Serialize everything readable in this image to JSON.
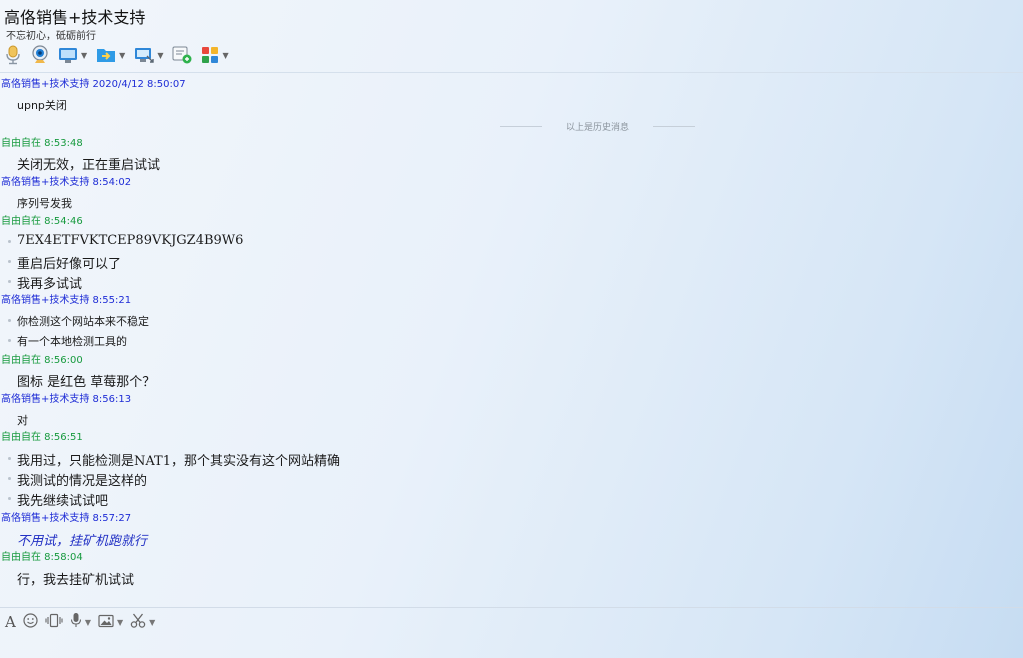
{
  "header": {
    "title": "高佫销售+技术支持",
    "subtitle": "不忘初心，砥砺前行",
    "toolbar": [
      {
        "icon": "microphone-icon"
      },
      {
        "icon": "webcam-icon"
      },
      {
        "icon": "screen-share-icon"
      },
      {
        "icon": "file-transfer-icon"
      },
      {
        "icon": "remote-desktop-icon"
      },
      {
        "icon": "new-chat-icon"
      },
      {
        "icon": "apps-icon"
      }
    ]
  },
  "chat": {
    "divider_text": "以上是历史消息",
    "messages": [
      {
        "sender": "高佫销售+技术支持 2020/4/12 8:50:07",
        "role": "staff",
        "lines": [
          "upnp关闭"
        ]
      },
      {
        "sender": "自由自在  8:53:48",
        "role": "user",
        "lines": [
          "关闭无效，正在重启试试"
        ]
      },
      {
        "sender": "高佫销售+技术支持  8:54:02",
        "role": "staff",
        "lines": [
          "序列号发我"
        ]
      },
      {
        "sender": "自由自在  8:54:46",
        "role": "user",
        "lines": [
          "7EX4ETFVKTCEP89VKJGZ4B9W6",
          "重启后好像可以了",
          "我再多试试"
        ]
      },
      {
        "sender": "高佫销售+技术支持  8:55:21",
        "role": "staff",
        "lines": [
          "你检测这个网站本来不稳定",
          "有一个本地检测工具的"
        ]
      },
      {
        "sender": "自由自在  8:56:00",
        "role": "user",
        "lines": [
          "图标 是红色 草莓那个？"
        ]
      },
      {
        "sender": "高佫销售+技术支持  8:56:13",
        "role": "staff",
        "lines": [
          "对"
        ]
      },
      {
        "sender": "自由自在  8:56:51",
        "role": "user",
        "lines": [
          "我用过，只能检测是NAT1，那个其实没有这个网站精确",
          "我测试的情况是这样的",
          "我先继续试试吧"
        ]
      },
      {
        "sender": "高佫销售+技术支持  8:57:27",
        "role": "staff",
        "lines": [
          "不用试，挂矿机跑就行"
        ]
      },
      {
        "sender": "自由自在  8:58:04",
        "role": "user",
        "lines": [
          "行，我去挂矿机试试"
        ]
      }
    ]
  },
  "input_toolbar": {
    "font_label": "A",
    "items": [
      {
        "icon": "font-icon"
      },
      {
        "icon": "emoji-icon"
      },
      {
        "icon": "vibrate-icon"
      },
      {
        "icon": "voice-icon"
      },
      {
        "icon": "image-icon"
      },
      {
        "icon": "scissors-icon"
      }
    ]
  },
  "colors": {
    "staff_name": "#1e2cd6",
    "user_name": "#179a3e",
    "highlight_message": "#2230c4"
  }
}
